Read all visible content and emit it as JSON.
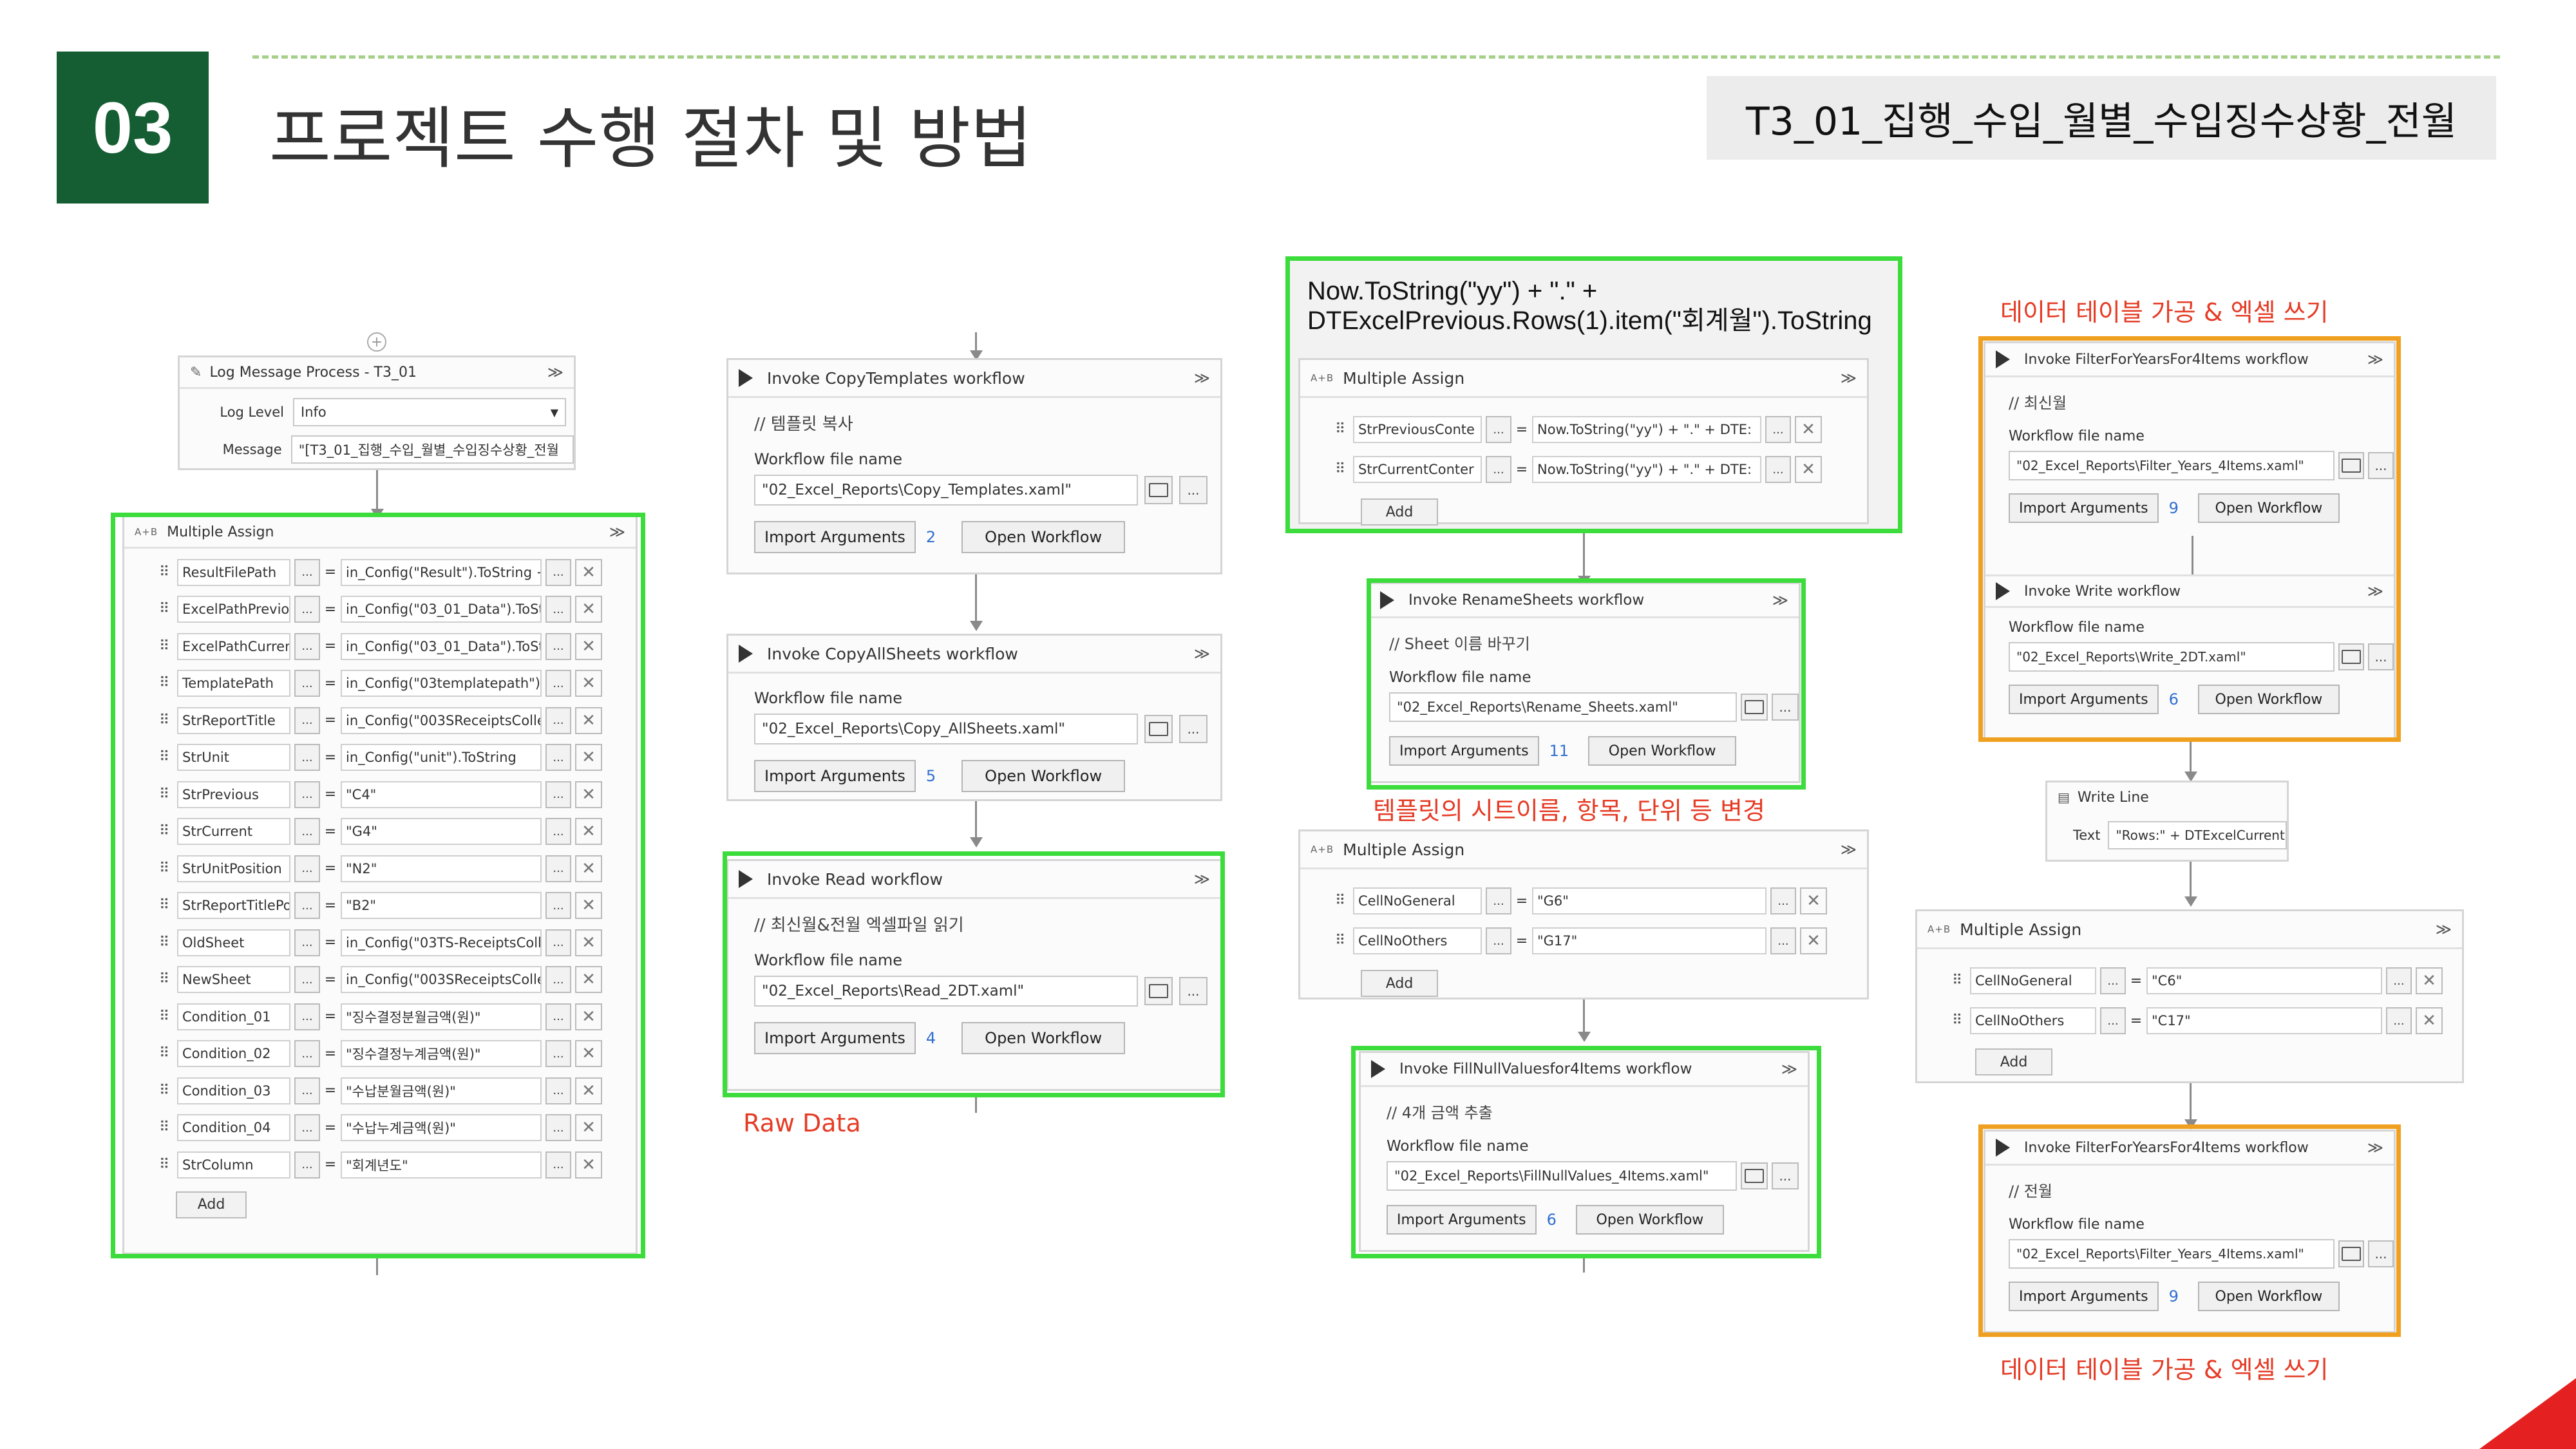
{
  "slide": {
    "number": "03",
    "title": "프로젝트 수행 절차 및 방법",
    "file_badge": "T3_01_집행_수입_월별_수입징수상황_전월"
  },
  "colors": {
    "green_header": "#155d33",
    "highlight_green": "#3bdc3b",
    "highlight_orange": "#f0a020",
    "note_red": "#e53c26",
    "accent_red": "#e52020"
  },
  "common": {
    "workflow_file_name_label": "Workflow file name",
    "import_arguments": "Import Arguments",
    "open_workflow": "Open Workflow",
    "add": "Add",
    "multiple_assign": "Multiple Assign",
    "dots": "...",
    "equals": "=",
    "collapse": "≫"
  },
  "log_message": {
    "title": "Log Message Process - T3_01",
    "log_level_label": "Log Level",
    "log_level_value": "Info",
    "message_label": "Message",
    "message_value": "\"[T3_01_집행_수입_월별_수입징수상황_전월"
  },
  "assign_left": {
    "rows": [
      {
        "name": "ResultFilePath",
        "value": "in_Config(\"Result\").ToString +"
      },
      {
        "name": "ExcelPathPreviou",
        "value": "in_Config(\"03_01_Data\").ToStri"
      },
      {
        "name": "ExcelPathCurrent",
        "value": "in_Config(\"03_01_Data\").ToStrir"
      },
      {
        "name": "TemplatePath",
        "value": "in_Config(\"03templatepath\").Tc"
      },
      {
        "name": "StrReportTitle",
        "value": "in_Config(\"003SReceiptsCollect"
      },
      {
        "name": "StrUnit",
        "value": "in_Config(\"unit\").ToString"
      },
      {
        "name": "StrPrevious",
        "value": "\"C4\""
      },
      {
        "name": "StrCurrent",
        "value": "\"G4\""
      },
      {
        "name": "StrUnitPosition",
        "value": "\"N2\""
      },
      {
        "name": "StrReportTitlePos",
        "value": "\"B2\""
      },
      {
        "name": "OldSheet",
        "value": "in_Config(\"03TS-ReceiptsCollec"
      },
      {
        "name": "NewSheet",
        "value": "in_Config(\"003SReceiptsCollect"
      },
      {
        "name": "Condition_01",
        "value": "\"징수결정분월금액(원)\""
      },
      {
        "name": "Condition_02",
        "value": "\"징수결정누계금액(원)\""
      },
      {
        "name": "Condition_03",
        "value": "\"수납분월금액(원)\""
      },
      {
        "name": "Condition_04",
        "value": "\"수납누계금액(원)\""
      },
      {
        "name": "StrColumn",
        "value": "\"회계년도\""
      }
    ]
  },
  "copy_templates": {
    "title": "Invoke CopyTemplates workflow",
    "comment": "// 템플릿 복사",
    "file": "\"02_Excel_Reports\\Copy_Templates.xaml\"",
    "count": "2"
  },
  "copy_all_sheets": {
    "title": "Invoke CopyAllSheets workflow",
    "file": "\"02_Excel_Reports\\Copy_AllSheets.xaml\"",
    "count": "5"
  },
  "read_workflow": {
    "title": "Invoke Read workflow",
    "comment": "// 최신월&전월 엑셀파일 읽기",
    "file": "\"02_Excel_Reports\\Read_2DT.xaml\"",
    "count": "4"
  },
  "raw_data_note": "Raw Data",
  "now_expr": {
    "line1": "Now.ToString(\"yy\") + \".\" +",
    "line2": "DTExcelPrevious.Rows(1).item(\"회계월\").ToString"
  },
  "assign_mid": {
    "rows": [
      {
        "name": "StrPreviousConte",
        "value": "Now.ToString(\"yy\") + \".\" + DTE:"
      },
      {
        "name": "StrCurrentConter",
        "value": "Now.ToString(\"yy\") + \".\" + DTE:"
      }
    ]
  },
  "rename_sheets": {
    "title": "Invoke RenameSheets workflow",
    "comment": "// Sheet 이름 바꾸기",
    "file": "\"02_Excel_Reports\\Rename_Sheets.xaml\"",
    "count": "11"
  },
  "rename_note": "템플릿의 시트이름, 항목, 단위 등 변경",
  "assign_mid2": {
    "rows": [
      {
        "name": "CellNoGeneral",
        "value": "\"G6\""
      },
      {
        "name": "CellNoOthers",
        "value": "\"G17\""
      }
    ]
  },
  "fill_null": {
    "title": "Invoke FillNullValuesfor4Items workflow",
    "comment": "// 4개 금액 추출",
    "file": "\"02_Excel_Reports\\FillNullValues_4Items.xaml\"",
    "count": "6"
  },
  "right_note_top": "데이터 테이블 가공 & 엑셀 쓰기",
  "filter_top": {
    "title": "Invoke FilterForYearsFor4Items workflow",
    "comment": "// 최신월",
    "file": "\"02_Excel_Reports\\Filter_Years_4Items.xaml\"",
    "count": "9"
  },
  "write_wf": {
    "title": "Invoke Write workflow",
    "file": "\"02_Excel_Reports\\Write_2DT.xaml\"",
    "count": "6"
  },
  "write_line": {
    "title": "Write Line",
    "text_label": "Text",
    "text_value": "\"Rows:\" + DTExcelCurrent.Ro"
  },
  "assign_right": {
    "rows": [
      {
        "name": "CellNoGeneral",
        "value": "\"C6\""
      },
      {
        "name": "CellNoOthers",
        "value": "\"C17\""
      }
    ]
  },
  "filter_bottom": {
    "title": "Invoke FilterForYearsFor4Items workflow",
    "comment": "// 전월",
    "file": "\"02_Excel_Reports\\Filter_Years_4Items.xaml\"",
    "count": "9"
  },
  "right_note_bottom": "데이터 테이블 가공 & 엑셀 쓰기"
}
